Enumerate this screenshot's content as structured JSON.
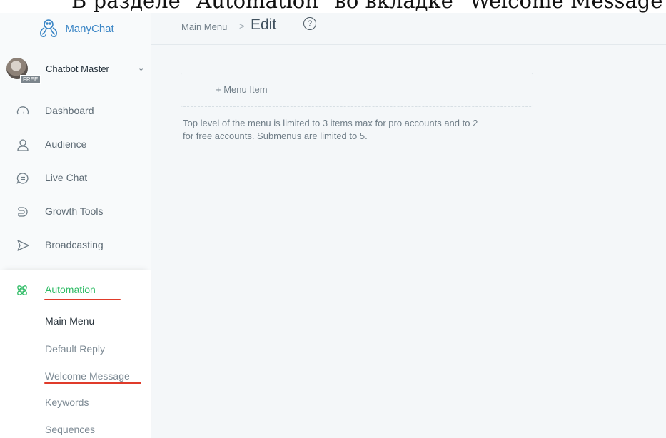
{
  "caption": "В разделе \"Automation\" во вкладке \"Welcome Message\":",
  "brand": {
    "name": "ManyChat"
  },
  "account": {
    "name": "Chatbot Master",
    "badge": "FREE"
  },
  "nav": [
    {
      "label": "Dashboard",
      "icon": "gauge-icon"
    },
    {
      "label": "Audience",
      "icon": "user-icon"
    },
    {
      "label": "Live Chat",
      "icon": "chat-icon"
    },
    {
      "label": "Growth Tools",
      "icon": "magnet-icon"
    },
    {
      "label": "Broadcasting",
      "icon": "send-icon"
    }
  ],
  "automation": {
    "label": "Automation",
    "icon": "atom-icon",
    "accent": "#2dbb64",
    "items": [
      {
        "label": "Main Menu",
        "active": true
      },
      {
        "label": "Default Reply"
      },
      {
        "label": "Welcome Message"
      },
      {
        "label": "Keywords"
      },
      {
        "label": "Sequences"
      }
    ]
  },
  "header": {
    "breadcrumb": "Main Menu",
    "separator": ">",
    "title": "Edit",
    "help": "?"
  },
  "main": {
    "add_item_label": "+ Menu Item",
    "hint_line1": "Top level of the menu is limited to 3 items max for pro accounts and to 2",
    "hint_line2": "for free accounts. Submenus are limited to 5."
  },
  "annotation_color": "#e03b2a"
}
